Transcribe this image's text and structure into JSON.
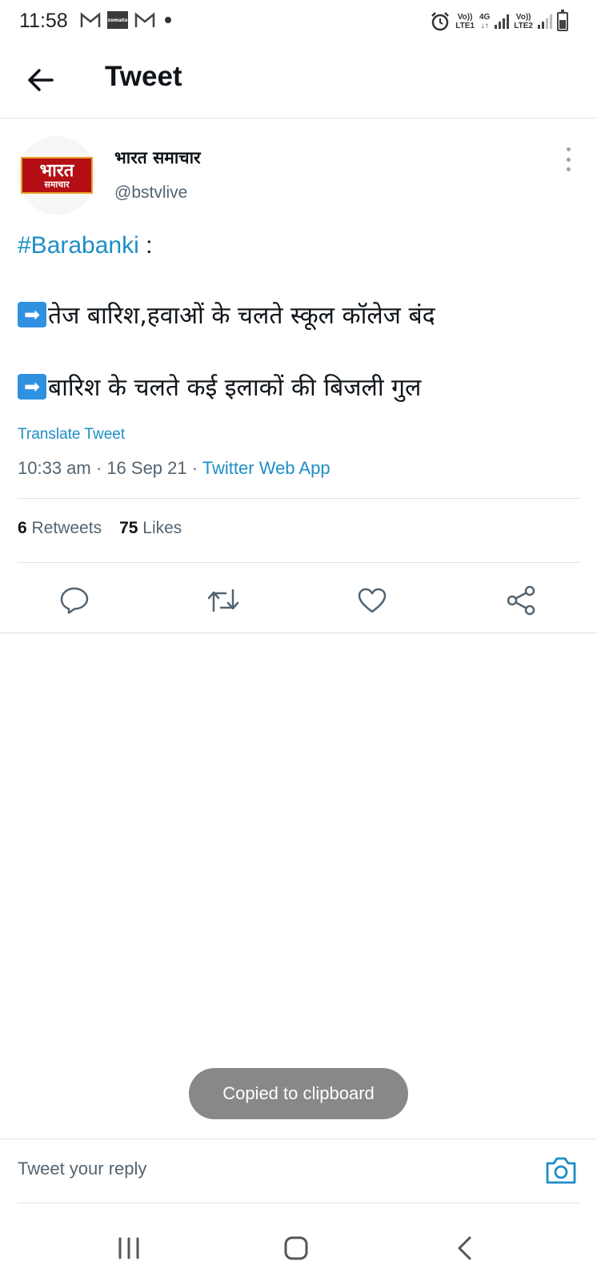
{
  "status_bar": {
    "time": "11:58",
    "zomato_label": "zomato",
    "sim1_top": "Vo))",
    "sim1_bottom": "LTE1",
    "network_top": "4G",
    "network_bottom": "↓↑",
    "sim2_top": "Vo))",
    "sim2_bottom": "LTE2"
  },
  "header": {
    "title": "Tweet"
  },
  "tweet": {
    "avatar_logo_top": "भारत",
    "avatar_logo_bottom": "समाचार",
    "display_name": "भारत समाचार",
    "handle": "@bstvlive",
    "hashtag": "#Barabanki",
    "hashtag_suffix": " :",
    "line1_emoji": "➡",
    "line1": "तेज बारिश,हवाओं के चलते स्कूल कॉलेज बंद",
    "line2_emoji": "➡",
    "line2": "बारिश के चलते कई इलाकों की बिजली गुल",
    "translate": "Translate Tweet",
    "time": "10:33 am",
    "date": "16 Sep 21",
    "separator": "·",
    "app": "Twitter Web App",
    "retweets_count": "6",
    "retweets_label": "Retweets",
    "likes_count": "75",
    "likes_label": "Likes"
  },
  "icons": {
    "back": "back-arrow-icon",
    "more": "more-vertical-icon",
    "reply": "reply-icon",
    "retweet": "retweet-icon",
    "like": "heart-icon",
    "share": "share-icon",
    "camera": "camera-icon"
  },
  "toast": {
    "message": "Copied to clipboard"
  },
  "reply_bar": {
    "placeholder": "Tweet your reply"
  },
  "colors": {
    "accent": "#1d8ec7",
    "text": "#0f1419",
    "secondary": "#536471",
    "toast_bg": "#888888"
  }
}
